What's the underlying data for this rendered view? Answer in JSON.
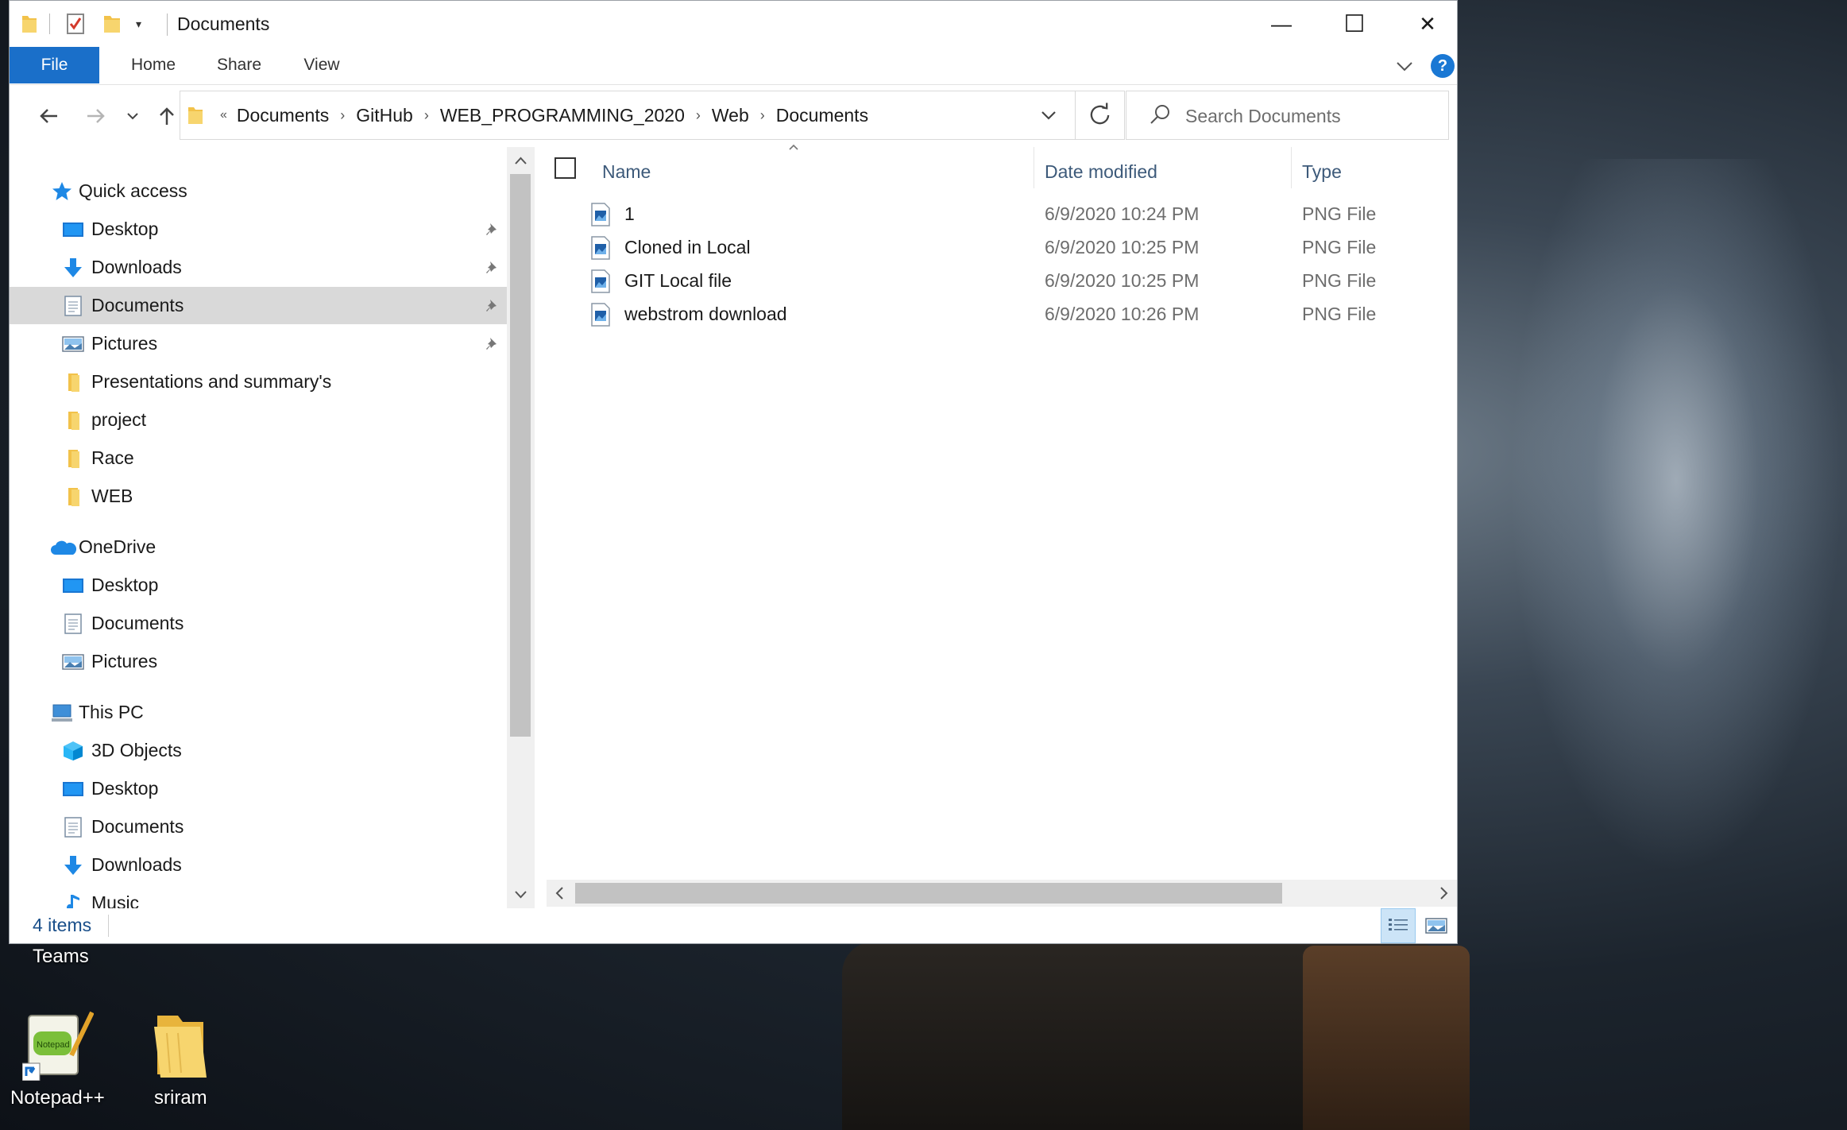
{
  "window": {
    "title": "Documents",
    "controls": {
      "minimize": "—",
      "maximize": "☐",
      "close": "✕"
    }
  },
  "ribbon": {
    "tabs": [
      "File",
      "Home",
      "Share",
      "View"
    ],
    "help": "?"
  },
  "address": {
    "overflow": "«",
    "breadcrumbs": [
      "Documents",
      "GitHub",
      "WEB_PROGRAMMING_2020",
      "Web",
      "Documents"
    ]
  },
  "search": {
    "placeholder": "Search Documents"
  },
  "nav_pane": {
    "quick_access": {
      "label": "Quick access",
      "items": [
        {
          "label": "Desktop",
          "icon": "desktop-icon",
          "pinned": true
        },
        {
          "label": "Downloads",
          "icon": "download-arrow-icon",
          "pinned": true
        },
        {
          "label": "Documents",
          "icon": "documents-icon",
          "pinned": true,
          "selected": true
        },
        {
          "label": "Pictures",
          "icon": "pictures-icon",
          "pinned": true
        },
        {
          "label": "Presentations and summary's",
          "icon": "folder-icon"
        },
        {
          "label": "project",
          "icon": "folder-icon"
        },
        {
          "label": "Race",
          "icon": "folder-icon"
        },
        {
          "label": "WEB",
          "icon": "folder-icon"
        }
      ]
    },
    "onedrive": {
      "label": "OneDrive",
      "items": [
        {
          "label": "Desktop",
          "icon": "desktop-icon"
        },
        {
          "label": "Documents",
          "icon": "documents-icon"
        },
        {
          "label": "Pictures",
          "icon": "pictures-icon"
        }
      ]
    },
    "this_pc": {
      "label": "This PC",
      "items": [
        {
          "label": "3D Objects",
          "icon": "3d-objects-icon"
        },
        {
          "label": "Desktop",
          "icon": "desktop-icon"
        },
        {
          "label": "Documents",
          "icon": "documents-icon"
        },
        {
          "label": "Downloads",
          "icon": "download-arrow-icon"
        },
        {
          "label": "Music",
          "icon": "music-icon"
        }
      ]
    }
  },
  "file_list": {
    "columns": {
      "name": "Name",
      "date": "Date modified",
      "type": "Type"
    },
    "rows": [
      {
        "name": "1",
        "date": "6/9/2020 10:24 PM",
        "type": "PNG File"
      },
      {
        "name": "Cloned in Local",
        "date": "6/9/2020 10:25 PM",
        "type": "PNG File"
      },
      {
        "name": "GIT Local file",
        "date": "6/9/2020 10:25 PM",
        "type": "PNG File"
      },
      {
        "name": "webstrom download",
        "date": "6/9/2020 10:26 PM",
        "type": "PNG File"
      }
    ]
  },
  "status": {
    "item_count": "4 items"
  },
  "desktop": {
    "partial_label": "Teams",
    "icons": [
      {
        "label": "Notepad++"
      },
      {
        "label": "sriram"
      }
    ]
  },
  "colors": {
    "accent": "#1a6fc9",
    "selected_bg": "#d9d9d9",
    "folder": "#f4c542"
  }
}
